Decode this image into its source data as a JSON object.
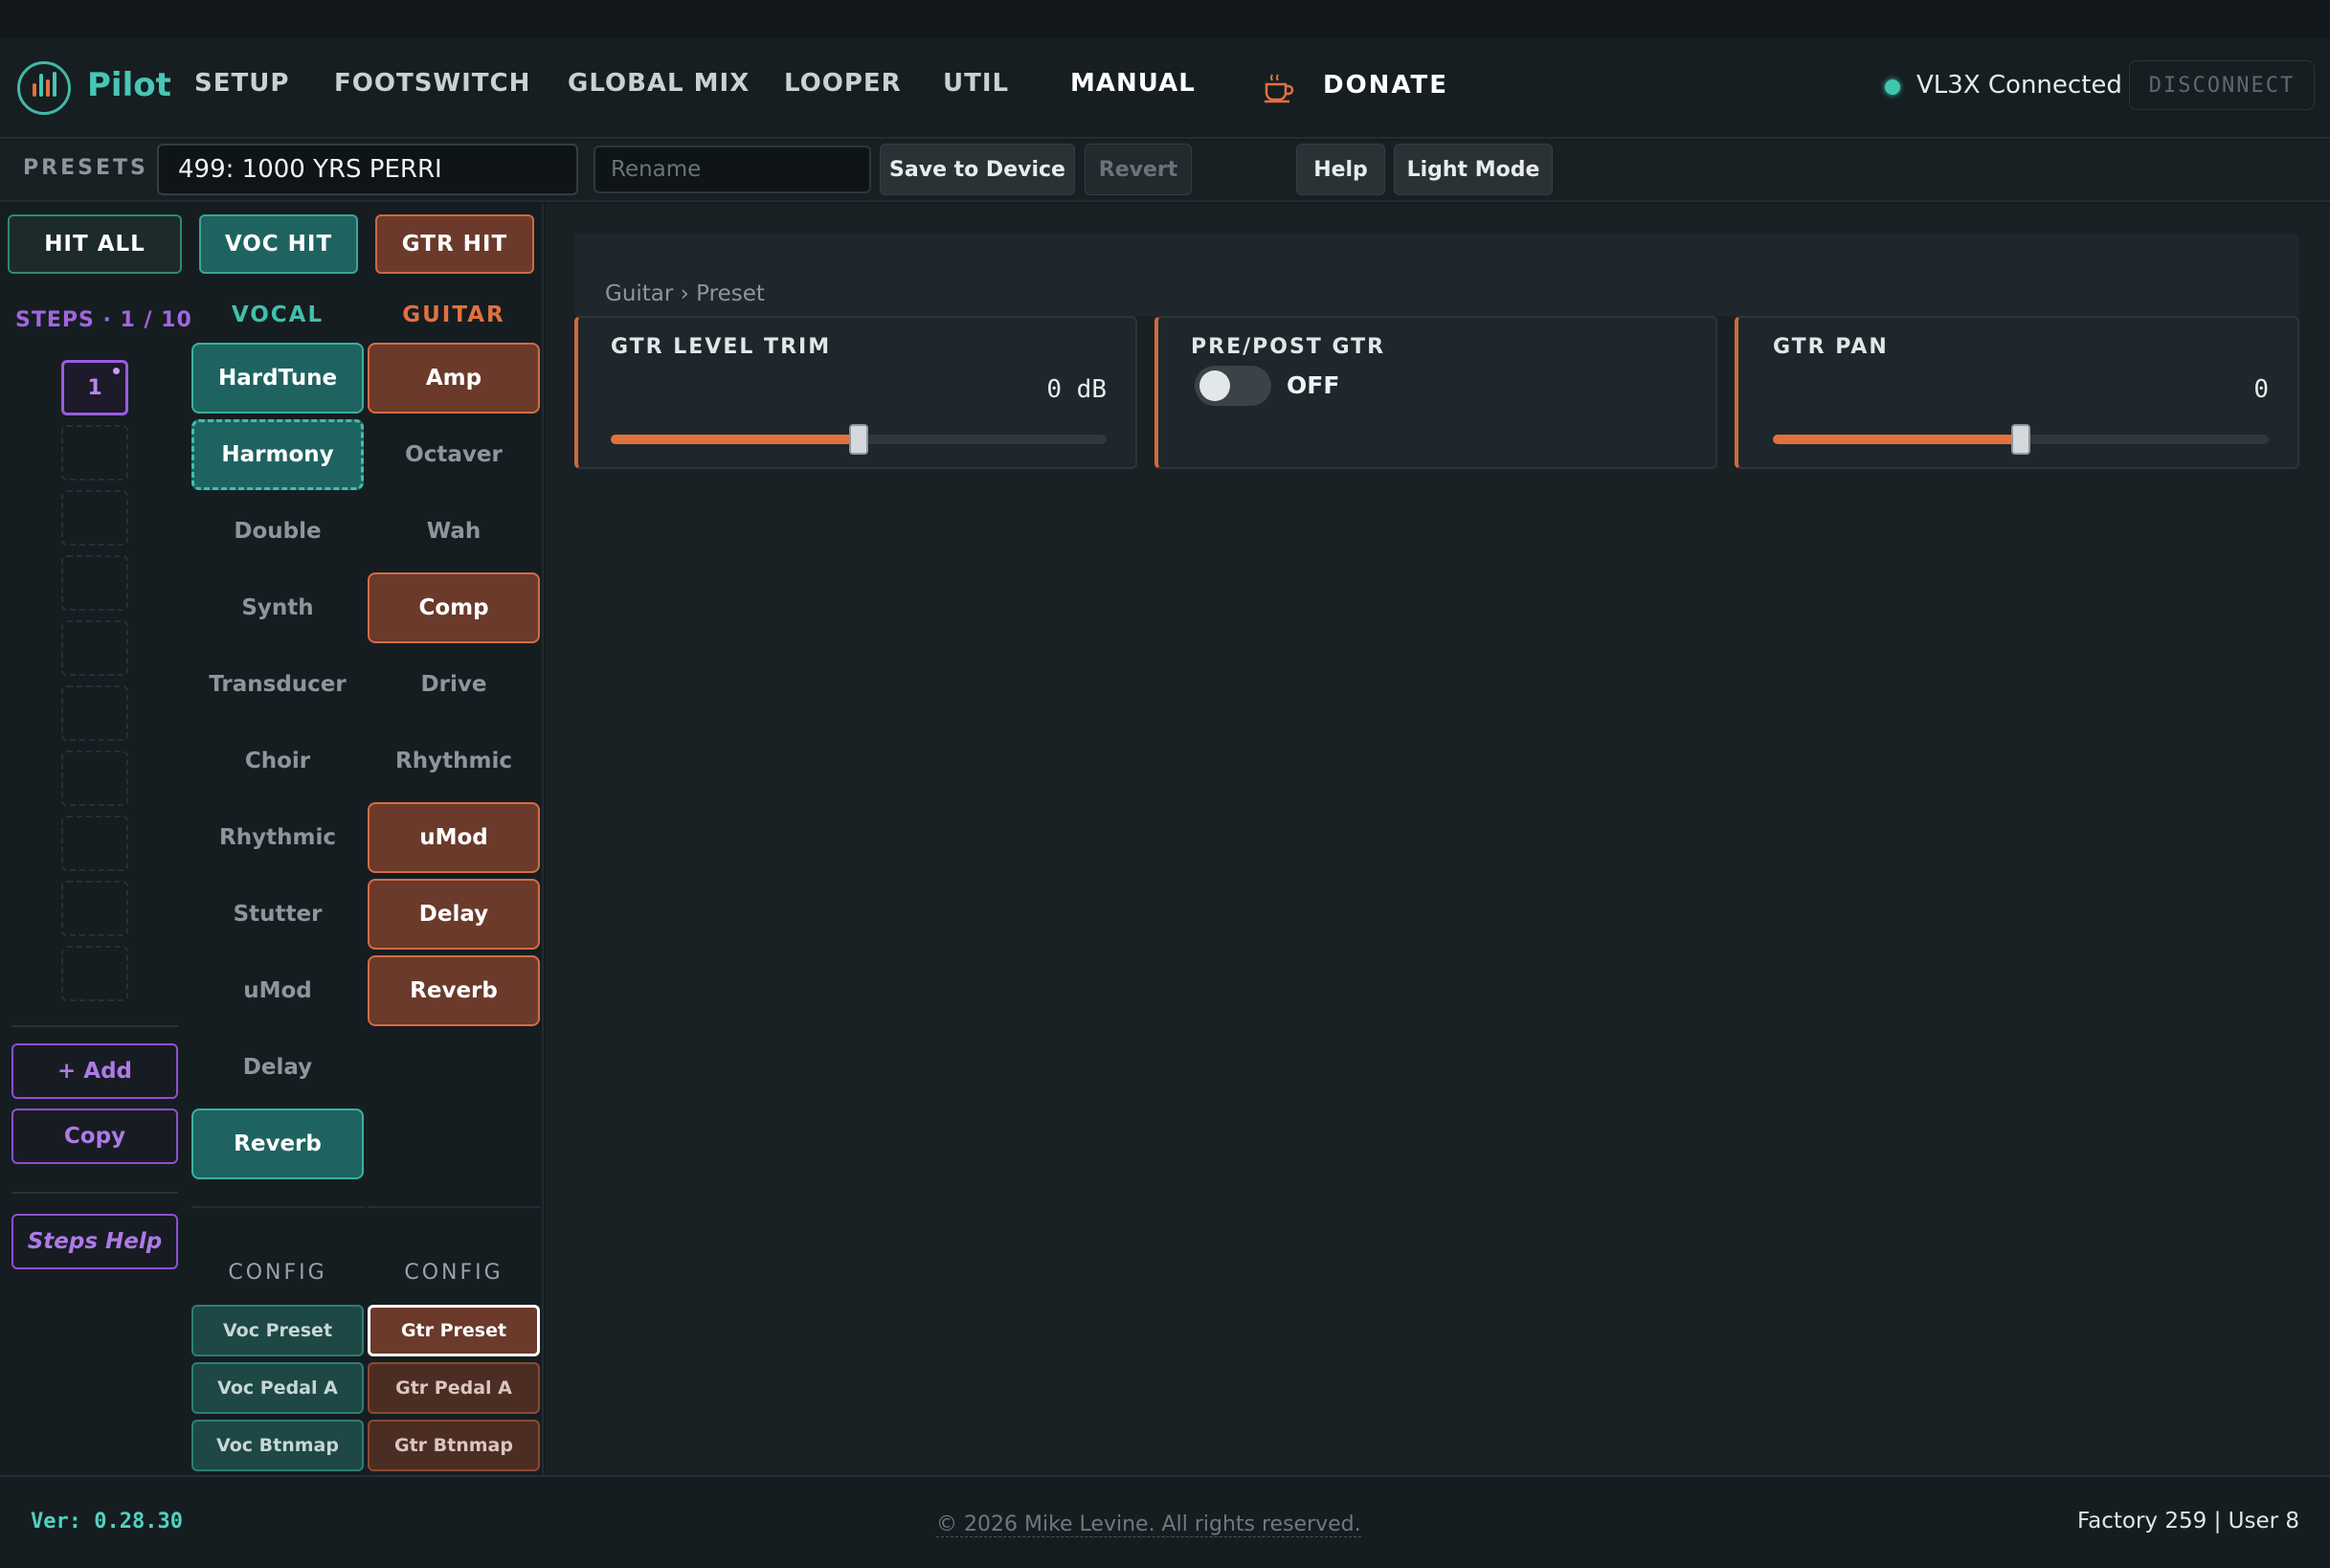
{
  "app": {
    "name": "Pilot"
  },
  "nav": {
    "items": [
      "SETUP",
      "FOOTSWITCH",
      "GLOBAL MIX",
      "LOOPER",
      "UTIL",
      "MANUAL"
    ],
    "donate": "DONATE",
    "status": "VL3X Connected",
    "disconnect": "DISCONNECT"
  },
  "presets": {
    "label": "PRESETS",
    "current": "499: 1000 YRS PERRI",
    "rename_placeholder": "Rename",
    "save": "Save to Device",
    "revert": "Revert",
    "help": "Help",
    "light_mode": "Light Mode"
  },
  "hits": {
    "all": "HIT ALL",
    "voc": "VOC HIT",
    "gtr": "GTR HIT"
  },
  "steps": {
    "label": "STEPS · 1 / 10",
    "active": "1",
    "add": "+ Add",
    "copy": "Copy",
    "help": "Steps Help"
  },
  "vocal": {
    "header": "VOCAL",
    "items": [
      {
        "label": "HardTune",
        "state": "on"
      },
      {
        "label": "Harmony",
        "state": "selected"
      },
      {
        "label": "Double",
        "state": "off"
      },
      {
        "label": "Synth",
        "state": "off"
      },
      {
        "label": "Transducer",
        "state": "off"
      },
      {
        "label": "Choir",
        "state": "off"
      },
      {
        "label": "Rhythmic",
        "state": "off"
      },
      {
        "label": "Stutter",
        "state": "off"
      },
      {
        "label": "uMod",
        "state": "off"
      },
      {
        "label": "Delay",
        "state": "off"
      },
      {
        "label": "Reverb",
        "state": "on"
      }
    ],
    "config_label": "CONFIG",
    "config": [
      "Voc Preset",
      "Voc Pedal A",
      "Voc Btnmap"
    ]
  },
  "guitar": {
    "header": "GUITAR",
    "items": [
      {
        "label": "Amp",
        "state": "on"
      },
      {
        "label": "Octaver",
        "state": "off"
      },
      {
        "label": "Wah",
        "state": "off"
      },
      {
        "label": "Comp",
        "state": "on"
      },
      {
        "label": "Drive",
        "state": "off"
      },
      {
        "label": "Rhythmic",
        "state": "off"
      },
      {
        "label": "uMod",
        "state": "on"
      },
      {
        "label": "Delay",
        "state": "on"
      },
      {
        "label": "Reverb",
        "state": "on"
      }
    ],
    "config_label": "CONFIG",
    "config": [
      "Gtr Preset",
      "Gtr Pedal A",
      "Gtr Btnmap"
    ]
  },
  "main": {
    "breadcrumb": "Guitar › Preset",
    "cards": {
      "level_trim": {
        "title": "GTR LEVEL TRIM",
        "value": "0 dB",
        "fraction": 0.5
      },
      "prepost": {
        "title": "PRE/POST GTR",
        "value": "OFF"
      },
      "pan": {
        "title": "GTR PAN",
        "value": "0",
        "fraction": 0.5
      }
    }
  },
  "footer": {
    "version": "Ver: 0.28.30",
    "copyright": "© 2026 Mike Levine. All rights reserved.",
    "counts": "Factory 259 | User 8"
  },
  "colors": {
    "accent_teal": "#48c6b4",
    "accent_orange": "#d4683e",
    "accent_purple": "#9b5be0"
  }
}
